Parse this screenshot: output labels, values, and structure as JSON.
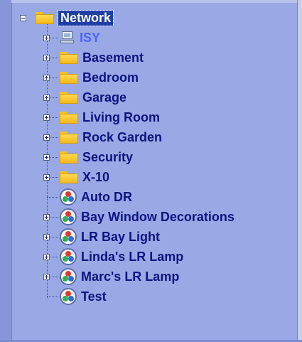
{
  "tree": {
    "root": {
      "label": "Network",
      "expanded": true,
      "icon": "folder-icon"
    },
    "children": [
      {
        "label": "ISY",
        "icon": "computer-icon",
        "expandable": true
      },
      {
        "label": "Basement",
        "icon": "folder-icon",
        "expandable": true
      },
      {
        "label": "Bedroom",
        "icon": "folder-icon",
        "expandable": true
      },
      {
        "label": "Garage",
        "icon": "folder-icon",
        "expandable": true
      },
      {
        "label": "Living Room",
        "icon": "folder-icon",
        "expandable": true
      },
      {
        "label": "Rock Garden",
        "icon": "folder-icon",
        "expandable": true
      },
      {
        "label": "Security",
        "icon": "folder-icon",
        "expandable": true
      },
      {
        "label": "X-10",
        "icon": "folder-icon",
        "expandable": true
      },
      {
        "label": "Auto DR",
        "icon": "scene-icon",
        "expandable": false
      },
      {
        "label": "Bay Window Decorations",
        "icon": "scene-icon",
        "expandable": true
      },
      {
        "label": "LR Bay Light",
        "icon": "scene-icon",
        "expandable": true
      },
      {
        "label": "Linda's LR Lamp",
        "icon": "scene-icon",
        "expandable": true
      },
      {
        "label": "Marc's LR Lamp",
        "icon": "scene-icon",
        "expandable": true
      },
      {
        "label": "Test",
        "icon": "scene-icon",
        "expandable": false
      }
    ]
  },
  "colors": {
    "background": "#9aa9e6",
    "label": "#0a1480",
    "isy_label": "#4a63ff",
    "selection": "#1f3fa6",
    "folder": "#ffd94f"
  }
}
